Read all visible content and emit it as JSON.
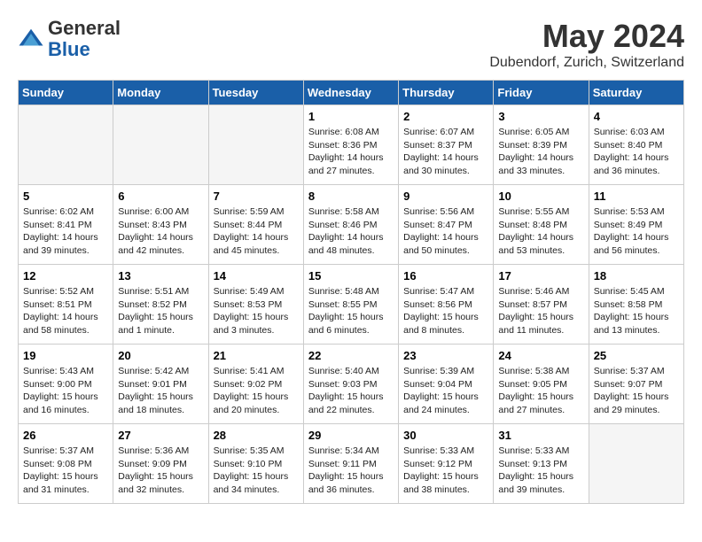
{
  "header": {
    "logo_line1": "General",
    "logo_line2": "Blue",
    "month_title": "May 2024",
    "location": "Dubendorf, Zurich, Switzerland"
  },
  "weekdays": [
    "Sunday",
    "Monday",
    "Tuesday",
    "Wednesday",
    "Thursday",
    "Friday",
    "Saturday"
  ],
  "weeks": [
    [
      {
        "day": "",
        "text": ""
      },
      {
        "day": "",
        "text": ""
      },
      {
        "day": "",
        "text": ""
      },
      {
        "day": "1",
        "text": "Sunrise: 6:08 AM\nSunset: 8:36 PM\nDaylight: 14 hours\nand 27 minutes."
      },
      {
        "day": "2",
        "text": "Sunrise: 6:07 AM\nSunset: 8:37 PM\nDaylight: 14 hours\nand 30 minutes."
      },
      {
        "day": "3",
        "text": "Sunrise: 6:05 AM\nSunset: 8:39 PM\nDaylight: 14 hours\nand 33 minutes."
      },
      {
        "day": "4",
        "text": "Sunrise: 6:03 AM\nSunset: 8:40 PM\nDaylight: 14 hours\nand 36 minutes."
      }
    ],
    [
      {
        "day": "5",
        "text": "Sunrise: 6:02 AM\nSunset: 8:41 PM\nDaylight: 14 hours\nand 39 minutes."
      },
      {
        "day": "6",
        "text": "Sunrise: 6:00 AM\nSunset: 8:43 PM\nDaylight: 14 hours\nand 42 minutes."
      },
      {
        "day": "7",
        "text": "Sunrise: 5:59 AM\nSunset: 8:44 PM\nDaylight: 14 hours\nand 45 minutes."
      },
      {
        "day": "8",
        "text": "Sunrise: 5:58 AM\nSunset: 8:46 PM\nDaylight: 14 hours\nand 48 minutes."
      },
      {
        "day": "9",
        "text": "Sunrise: 5:56 AM\nSunset: 8:47 PM\nDaylight: 14 hours\nand 50 minutes."
      },
      {
        "day": "10",
        "text": "Sunrise: 5:55 AM\nSunset: 8:48 PM\nDaylight: 14 hours\nand 53 minutes."
      },
      {
        "day": "11",
        "text": "Sunrise: 5:53 AM\nSunset: 8:49 PM\nDaylight: 14 hours\nand 56 minutes."
      }
    ],
    [
      {
        "day": "12",
        "text": "Sunrise: 5:52 AM\nSunset: 8:51 PM\nDaylight: 14 hours\nand 58 minutes."
      },
      {
        "day": "13",
        "text": "Sunrise: 5:51 AM\nSunset: 8:52 PM\nDaylight: 15 hours\nand 1 minute."
      },
      {
        "day": "14",
        "text": "Sunrise: 5:49 AM\nSunset: 8:53 PM\nDaylight: 15 hours\nand 3 minutes."
      },
      {
        "day": "15",
        "text": "Sunrise: 5:48 AM\nSunset: 8:55 PM\nDaylight: 15 hours\nand 6 minutes."
      },
      {
        "day": "16",
        "text": "Sunrise: 5:47 AM\nSunset: 8:56 PM\nDaylight: 15 hours\nand 8 minutes."
      },
      {
        "day": "17",
        "text": "Sunrise: 5:46 AM\nSunset: 8:57 PM\nDaylight: 15 hours\nand 11 minutes."
      },
      {
        "day": "18",
        "text": "Sunrise: 5:45 AM\nSunset: 8:58 PM\nDaylight: 15 hours\nand 13 minutes."
      }
    ],
    [
      {
        "day": "19",
        "text": "Sunrise: 5:43 AM\nSunset: 9:00 PM\nDaylight: 15 hours\nand 16 minutes."
      },
      {
        "day": "20",
        "text": "Sunrise: 5:42 AM\nSunset: 9:01 PM\nDaylight: 15 hours\nand 18 minutes."
      },
      {
        "day": "21",
        "text": "Sunrise: 5:41 AM\nSunset: 9:02 PM\nDaylight: 15 hours\nand 20 minutes."
      },
      {
        "day": "22",
        "text": "Sunrise: 5:40 AM\nSunset: 9:03 PM\nDaylight: 15 hours\nand 22 minutes."
      },
      {
        "day": "23",
        "text": "Sunrise: 5:39 AM\nSunset: 9:04 PM\nDaylight: 15 hours\nand 24 minutes."
      },
      {
        "day": "24",
        "text": "Sunrise: 5:38 AM\nSunset: 9:05 PM\nDaylight: 15 hours\nand 27 minutes."
      },
      {
        "day": "25",
        "text": "Sunrise: 5:37 AM\nSunset: 9:07 PM\nDaylight: 15 hours\nand 29 minutes."
      }
    ],
    [
      {
        "day": "26",
        "text": "Sunrise: 5:37 AM\nSunset: 9:08 PM\nDaylight: 15 hours\nand 31 minutes."
      },
      {
        "day": "27",
        "text": "Sunrise: 5:36 AM\nSunset: 9:09 PM\nDaylight: 15 hours\nand 32 minutes."
      },
      {
        "day": "28",
        "text": "Sunrise: 5:35 AM\nSunset: 9:10 PM\nDaylight: 15 hours\nand 34 minutes."
      },
      {
        "day": "29",
        "text": "Sunrise: 5:34 AM\nSunset: 9:11 PM\nDaylight: 15 hours\nand 36 minutes."
      },
      {
        "day": "30",
        "text": "Sunrise: 5:33 AM\nSunset: 9:12 PM\nDaylight: 15 hours\nand 38 minutes."
      },
      {
        "day": "31",
        "text": "Sunrise: 5:33 AM\nSunset: 9:13 PM\nDaylight: 15 hours\nand 39 minutes."
      },
      {
        "day": "",
        "text": ""
      }
    ]
  ]
}
